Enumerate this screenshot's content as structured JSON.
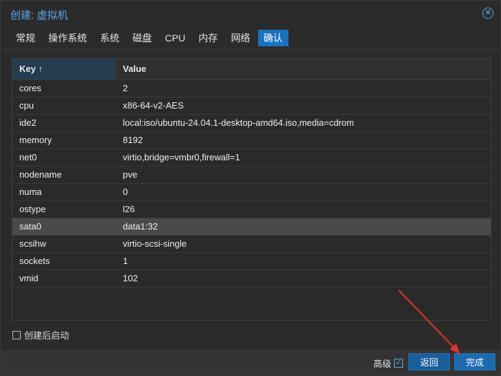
{
  "dialog": {
    "title": "创建: 虚拟机",
    "close_glyph": "✕"
  },
  "tabs": [
    {
      "label": "常规"
    },
    {
      "label": "操作系统"
    },
    {
      "label": "系统"
    },
    {
      "label": "磁盘"
    },
    {
      "label": "CPU"
    },
    {
      "label": "内存"
    },
    {
      "label": "网络"
    },
    {
      "label": "确认",
      "active": true
    }
  ],
  "grid": {
    "key_header": "Key ↑",
    "value_header": "Value",
    "rows": [
      {
        "key": "cores",
        "value": "2"
      },
      {
        "key": "cpu",
        "value": "x86-64-v2-AES"
      },
      {
        "key": "ide2",
        "value": "local:iso/ubuntu-24.04.1-desktop-amd64.iso,media=cdrom"
      },
      {
        "key": "memory",
        "value": "8192"
      },
      {
        "key": "net0",
        "value": "virtio,bridge=vmbr0,firewall=1"
      },
      {
        "key": "nodename",
        "value": "pve"
      },
      {
        "key": "numa",
        "value": "0"
      },
      {
        "key": "ostype",
        "value": "l26"
      },
      {
        "key": "sata0",
        "value": "data1:32",
        "selected": true
      },
      {
        "key": "scsihw",
        "value": "virtio-scsi-single"
      },
      {
        "key": "sockets",
        "value": "1"
      },
      {
        "key": "vmid",
        "value": "102"
      }
    ]
  },
  "startup_checkbox": {
    "label": "创建后启动",
    "checked": false
  },
  "footer": {
    "advanced_label": "高级",
    "advanced_checked": true,
    "advanced_check_glyph": "✓",
    "back_label": "返回",
    "finish_label": "完成"
  },
  "colors": {
    "accent": "#59a7e6",
    "active_tab": "#1a73c0",
    "annotation_arrow": "#e8302a"
  }
}
